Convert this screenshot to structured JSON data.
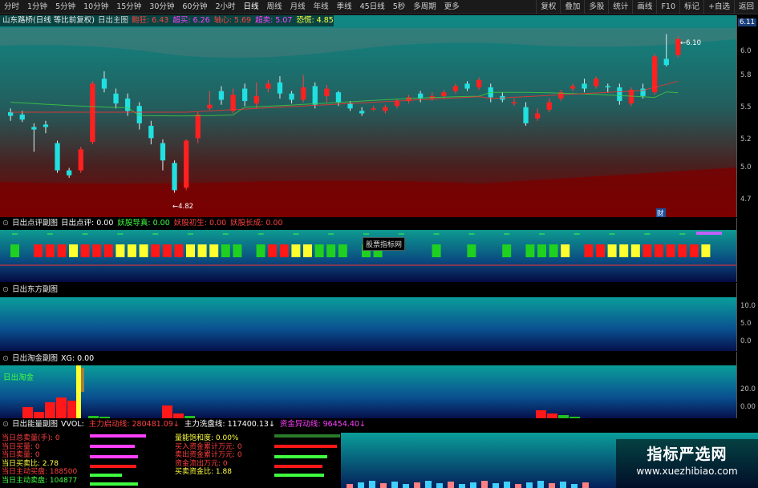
{
  "toolbar": {
    "periods": [
      "分时",
      "1分钟",
      "5分钟",
      "10分钟",
      "15分钟",
      "30分钟",
      "60分钟",
      "2小时",
      "日线",
      "周线",
      "月线",
      "年线",
      "季线",
      "45日线",
      "5秒",
      "多周期",
      "更多"
    ],
    "active_index": 8,
    "right_buttons": [
      "复权",
      "叠加",
      "多股",
      "统计",
      "画线",
      "F10",
      "标记",
      "+自选",
      "返回"
    ]
  },
  "main": {
    "stock": "山东路桥(日线 等比前复权)",
    "indicator": "日出主图",
    "fields": [
      {
        "label": "鲍狂:",
        "value": "6.43",
        "color": "#ff4040"
      },
      {
        "label": "超买:",
        "value": "6.26",
        "color": "#ff40ff"
      },
      {
        "label": "轴心:",
        "value": "5.69",
        "color": "#ff4040"
      },
      {
        "label": "超卖:",
        "value": "5.07",
        "color": "#ff40ff"
      },
      {
        "label": "恐慌:",
        "value": "4.85",
        "color": "#ffff40"
      }
    ],
    "axis_labels": [
      "6.11",
      "6.0",
      "5.8",
      "5.5",
      "5.2",
      "5.0",
      "4.7"
    ],
    "high_label": "6.10",
    "low_label": "4.82",
    "marker": "财"
  },
  "panel2": {
    "title": "日出点评副图",
    "fields": [
      {
        "label": "日出点评:",
        "value": "0.00",
        "color": "#ffffff"
      },
      {
        "label": "妖股导真:",
        "value": "0.00",
        "color": "#40ff40"
      },
      {
        "label": "妖股初生:",
        "value": "0.00",
        "color": "#ff4040"
      },
      {
        "label": "妖股长成:",
        "value": "0.00",
        "color": "#ff4040"
      }
    ],
    "tooltip": "股票指标网",
    "blocks": [
      "g",
      null,
      "r",
      "r",
      "r",
      "y",
      "r",
      "r",
      "r",
      "y",
      "y",
      "y",
      "r",
      "r",
      "r",
      "y",
      "y",
      "y",
      "g",
      "g",
      null,
      "g",
      "r",
      "r",
      "y",
      "y",
      "g",
      "g",
      "g",
      null,
      "g",
      "g",
      null,
      null,
      null,
      null,
      "g",
      null,
      null,
      "g",
      null,
      null,
      "g",
      null,
      "g",
      "g",
      "g",
      "y",
      null,
      "r",
      "r",
      "y",
      "y",
      "y",
      "r",
      "r",
      "r",
      "r",
      "r",
      "y"
    ]
  },
  "panel3": {
    "title": "日出东方副图",
    "axis_labels": [
      "10.0",
      "5.0",
      "0.0"
    ]
  },
  "panel4": {
    "title": "日出淘金副图",
    "fields": [
      {
        "label": "XG:",
        "value": "0.00",
        "color": "#ffffff"
      }
    ],
    "label": "日出淘金",
    "axis_labels": [
      "20.0",
      "0.00"
    ]
  },
  "panel5": {
    "title": "日出能量副图",
    "fields": [
      {
        "label": "VVOL:",
        "value": "",
        "color": "#ffffff"
      },
      {
        "label": "主力启动线:",
        "value": "280481.09↓",
        "color": "#ff4040"
      },
      {
        "label": "主力洗盘线:",
        "value": "117400.13↓",
        "color": "#ffffff"
      },
      {
        "label": "资金异动线:",
        "value": "96454.40↓",
        "color": "#ff40ff"
      }
    ],
    "left_stats": [
      {
        "text": "当日总卖量(手): 0",
        "color": "#ff4040"
      },
      {
        "text": "当日买量: 0",
        "color": "#ff4040"
      },
      {
        "text": "当日卖量: 0",
        "color": "#ff4040"
      },
      {
        "text": "当日买卖比: 2.78",
        "color": "#ffff40"
      },
      {
        "text": "当日主动买盘: 188500",
        "color": "#ff4040"
      },
      {
        "text": "当日主动卖盘: 104877",
        "color": "#40ff40"
      }
    ],
    "mid_stats": [
      {
        "text": "量能饱和度: 0.00%",
        "color": "#ffff40"
      },
      {
        "text": "买入资金累计万元: 0",
        "color": "#ff4040"
      },
      {
        "text": "卖出资金累计万元: 0",
        "color": "#ff4040"
      },
      {
        "text": "资金流出万元: 0",
        "color": "#ff4040"
      },
      {
        "text": "买卖资金比: 1.88",
        "color": "#ffff40"
      }
    ]
  },
  "watermark": {
    "title": "指标严选网",
    "url": "www.xuezhibiao.com"
  }
}
